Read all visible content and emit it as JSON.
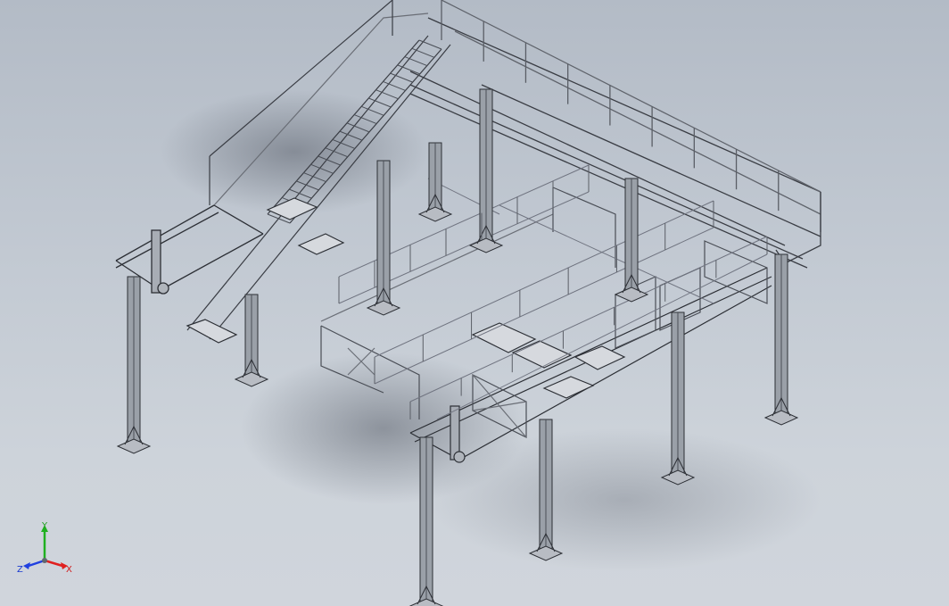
{
  "viewport": {
    "background_top": "#b3bbc6",
    "background_bottom": "#d0d5dc",
    "model_stroke": "#2a2d33",
    "rail_stroke": "#5c6068",
    "leg_fill": "#9aa0a8"
  },
  "triad": {
    "x_label": "X",
    "y_label": "Y",
    "z_label": "Z",
    "x_color": "#e02020",
    "y_color": "#20b020",
    "z_color": "#2040e0"
  }
}
